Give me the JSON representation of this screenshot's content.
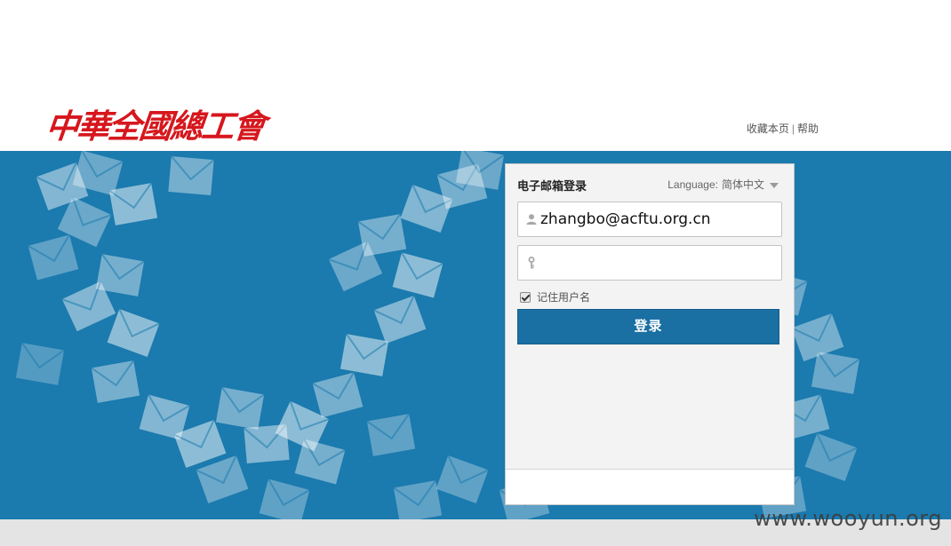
{
  "header": {
    "logo_text": "中華全國總工會",
    "links": {
      "bookmark": "收藏本页",
      "separator": "|",
      "help": "帮助"
    }
  },
  "login": {
    "title": "电子邮箱登录",
    "language_label": "Language:",
    "language_value": "简体中文",
    "username_value": "zhangbo@acftu.org.cn",
    "password_value": "",
    "remember_label": "记住用户名",
    "remember_checked": true,
    "submit_label": "登录"
  },
  "watermark": "www.wooyun.org",
  "colors": {
    "banner": "#1b7aae",
    "button": "#1a6fa3",
    "logo": "#d6171d",
    "footer": "#e4e4e4"
  },
  "icons": {
    "username": "user-icon",
    "password": "key-icon",
    "language": "chevron-down-icon"
  }
}
